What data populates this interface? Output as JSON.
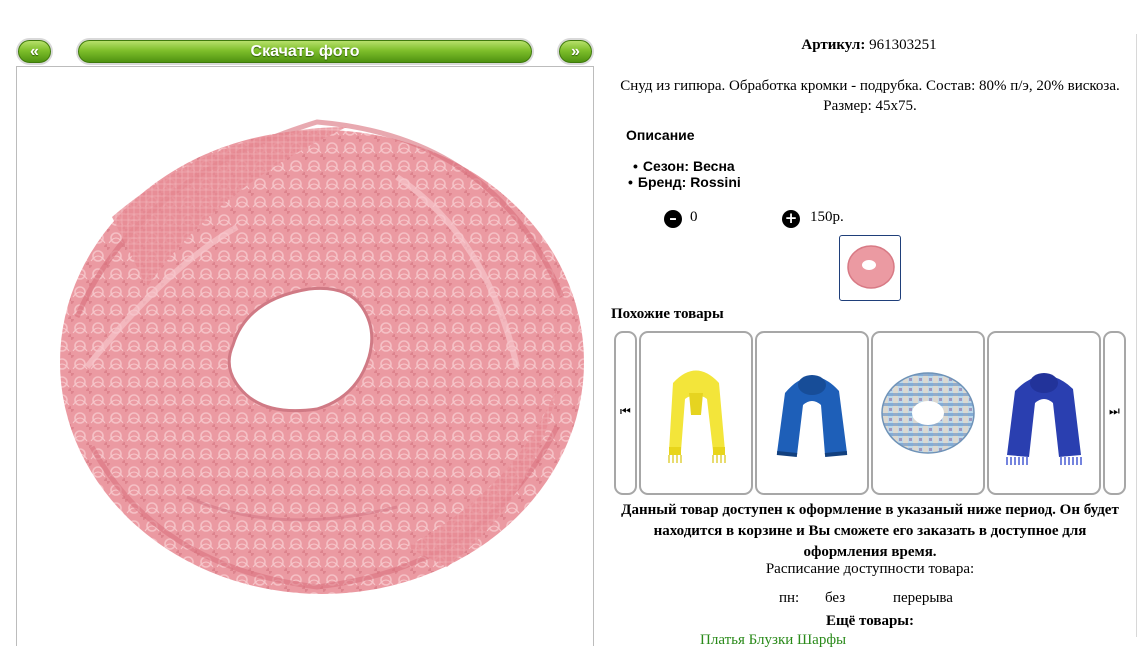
{
  "viewer": {
    "prev_label": "«",
    "download_label": "Скачать фото",
    "next_label": "»"
  },
  "product": {
    "article_label": "Артикул:",
    "article_value": "961303251",
    "description_line1": "Снуд из гипюра. Обработка кромки - подрубка. Состав: 80% п/э, 20% вискоза.",
    "description_line2": "Размер: 45x75.",
    "desc_heading": "Описание",
    "props": [
      {
        "text": "Сезон: Весна"
      },
      {
        "text": "Бренд: Rossini"
      }
    ],
    "quantity": "0",
    "price": "150р.",
    "colors": {
      "accent_green": "#6fb322",
      "lace_pink": "#e98f97"
    }
  },
  "similar": {
    "title": "Похожие товары",
    "items": [
      {
        "name": "yellow-scarf",
        "color": "#f3e53a"
      },
      {
        "name": "blue-scarf",
        "color": "#1e5fb8"
      },
      {
        "name": "multicolor-snood",
        "color": "#9fc4dc"
      },
      {
        "name": "royal-blue-scarf",
        "color": "#2a3fb0"
      }
    ]
  },
  "availability": {
    "notice_line1": "Данный товар доступен к оформление в указаный ниже период. Он будет",
    "notice_line2": "находится в корзине и Вы сможете его заказать в доступное для",
    "notice_line3": "оформления время.",
    "schedule_title": "Расписание доступности товара:",
    "day": "пн:",
    "from": "без",
    "to": "перерыва"
  },
  "more": {
    "title": "Ещё товары:",
    "links": "Платья   Блузки   Шарфы"
  },
  "icons": {
    "prev": "double-left-arrow-icon",
    "next": "double-right-arrow-icon",
    "minus": "minus-circle-icon",
    "plus": "plus-circle-icon",
    "carousel_prev": "skip-back-icon",
    "carousel_next": "skip-forward-icon"
  }
}
